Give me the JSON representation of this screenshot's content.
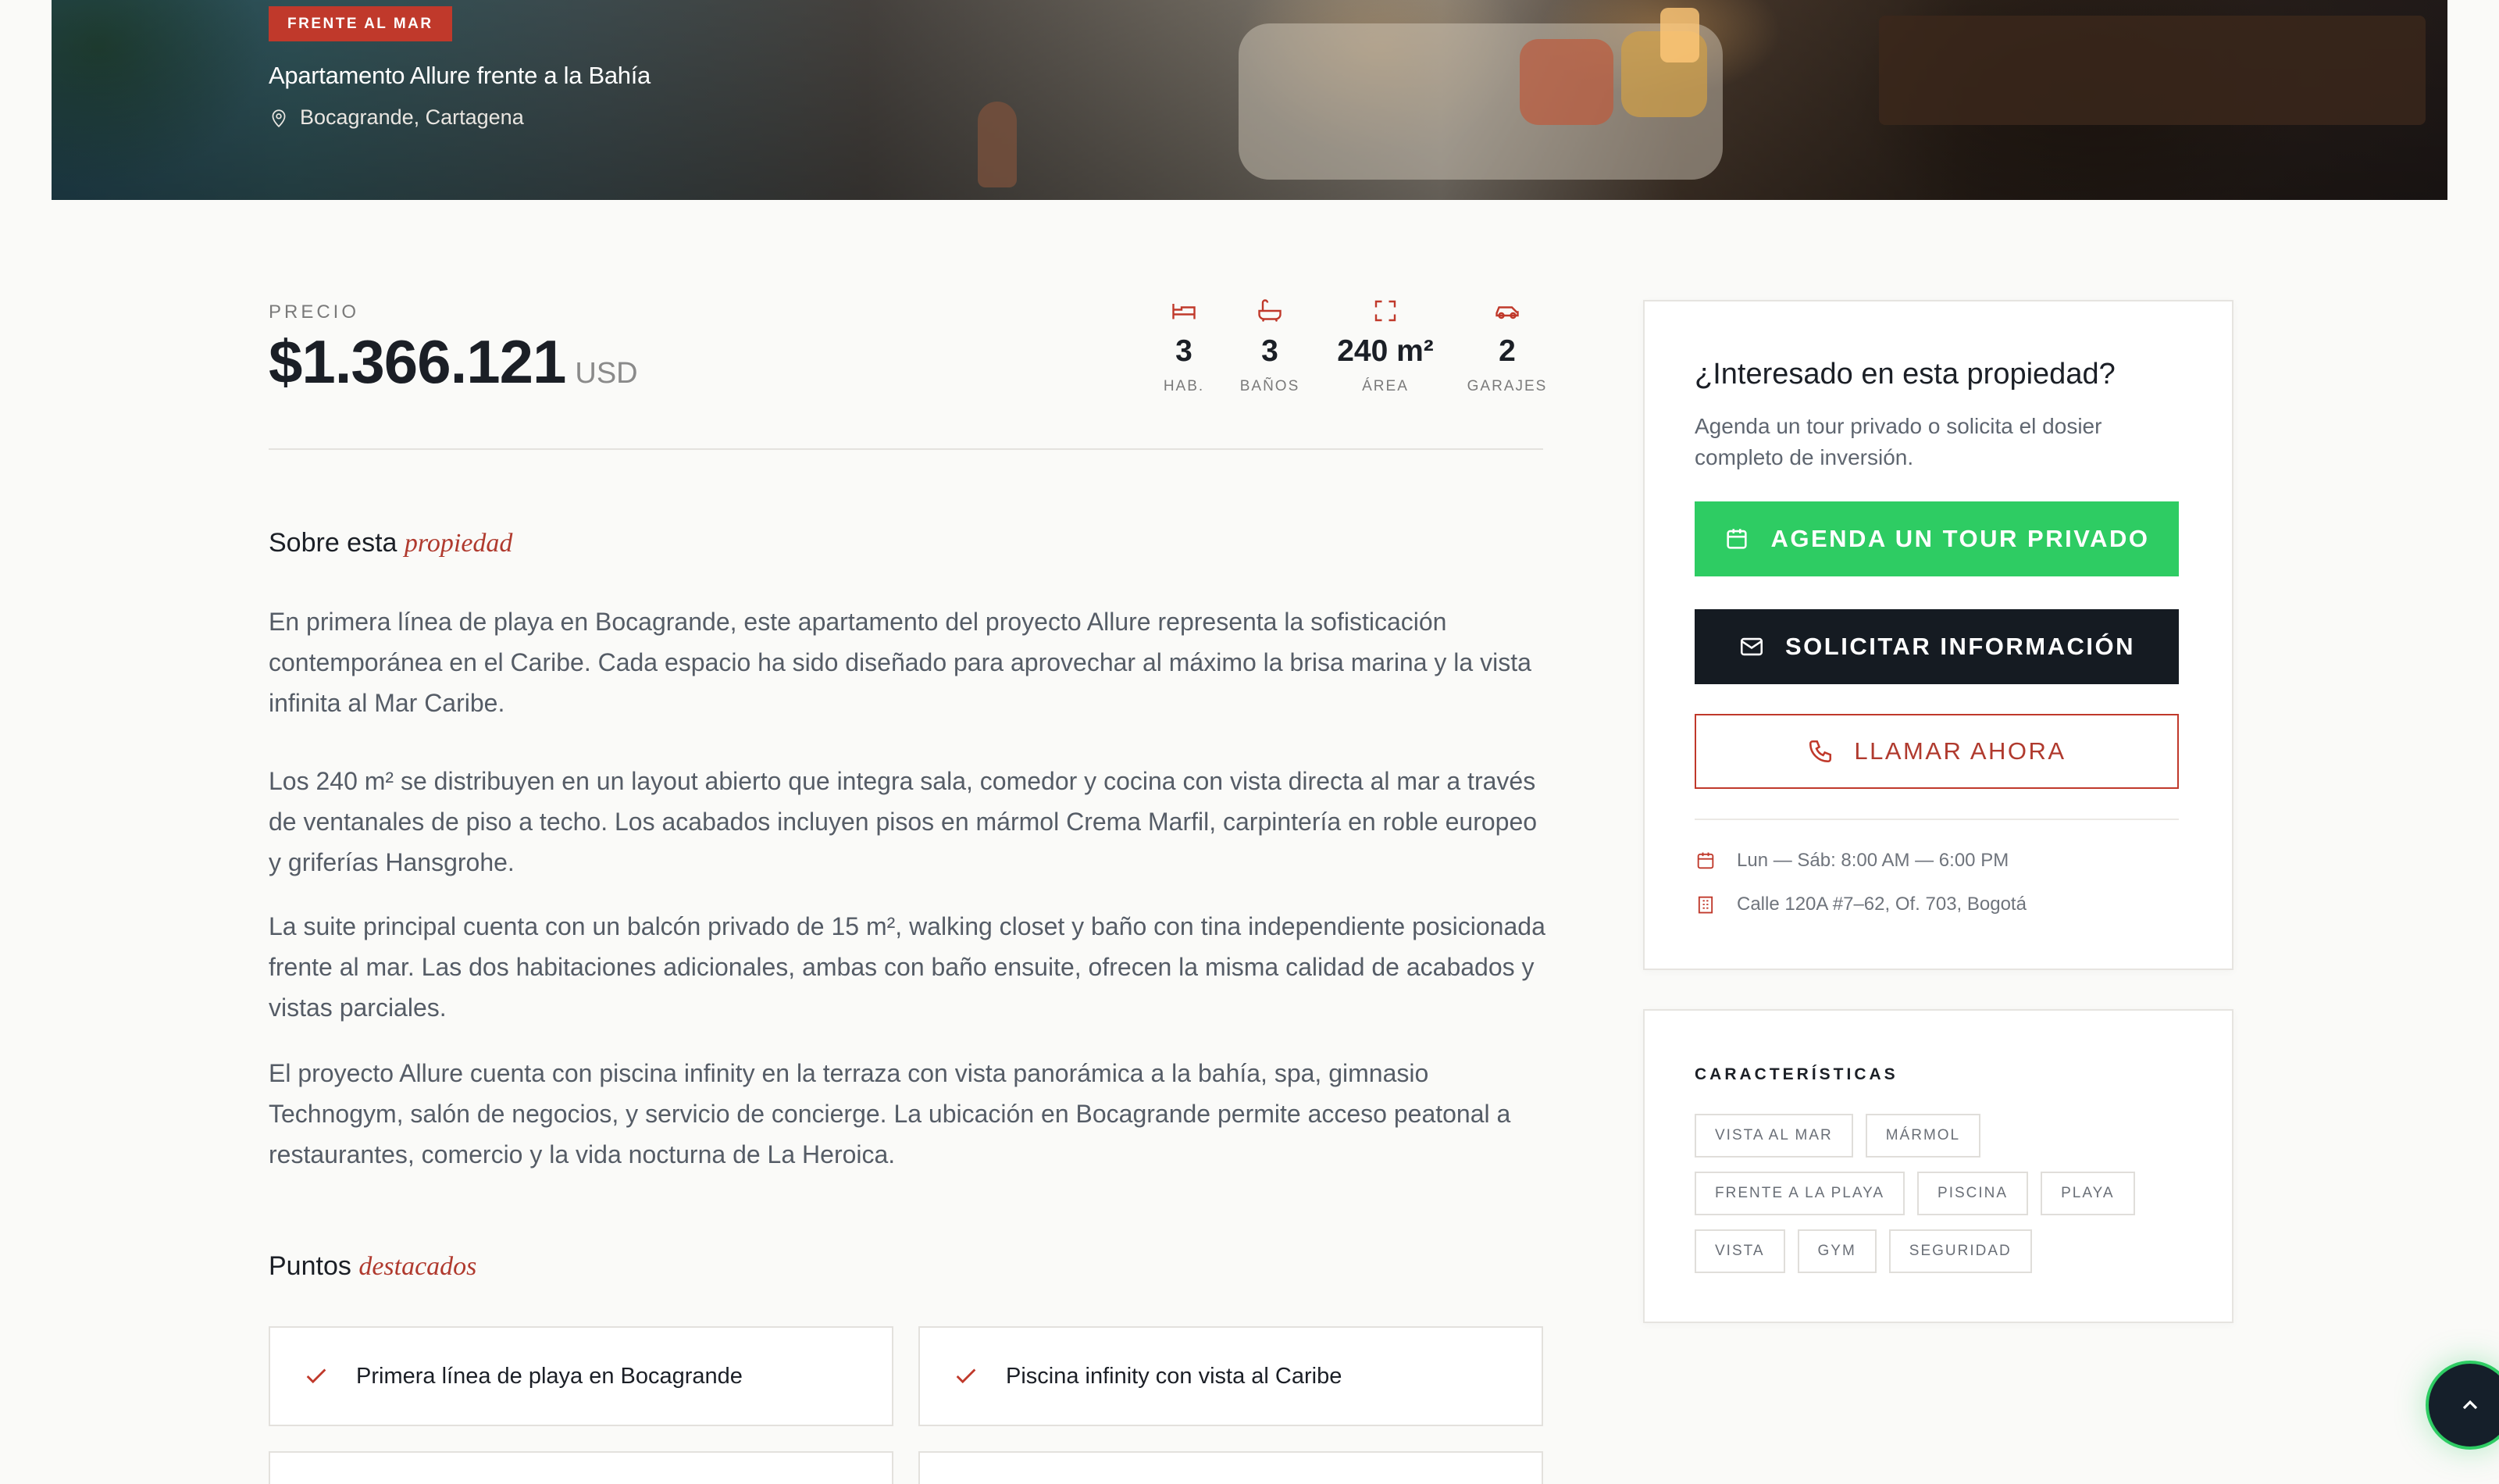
{
  "hero": {
    "badge": "FRENTE AL MAR",
    "title": "Apartamento Allure frente a la Bahía",
    "location": "Bocagrande, Cartagena",
    "location_icon": "map-pin-icon"
  },
  "price": {
    "label": "PRECIO",
    "value": "$1.366.121",
    "currency": "USD"
  },
  "stats": [
    {
      "icon": "bed-icon",
      "value": "3",
      "label": "HAB."
    },
    {
      "icon": "bathtub-icon",
      "value": "3",
      "label": "BAÑOS"
    },
    {
      "icon": "area-icon",
      "value": "240 m²",
      "label": "ÁREA"
    },
    {
      "icon": "car-icon",
      "value": "2",
      "label": "GARAJES"
    }
  ],
  "about": {
    "title_plain": "Sobre esta",
    "title_em": "propiedad",
    "paragraphs": [
      "En primera línea de playa en Bocagrande, este apartamento del proyecto Allure representa la sofisticación contemporánea en el Caribe. Cada espacio ha sido diseñado para aprovechar al máximo la brisa marina y la vista infinita al Mar Caribe.",
      "Los 240 m² se distribuyen en un layout abierto que integra sala, comedor y cocina con vista directa al mar a través de ventanales de piso a techo. Los acabados incluyen pisos en mármol Crema Marfil, carpintería en roble europeo y griferías Hansgrohe.",
      "La suite principal cuenta con un balcón privado de 15 m², walking closet y baño con tina independiente posicionada frente al mar. Las dos habitaciones adicionales, ambas con baño ensuite, ofrecen la misma calidad de acabados y vistas parciales.",
      "El proyecto Allure cuenta con piscina infinity en la terraza con vista panorámica a la bahía, spa, gimnasio Technogym, salón de negocios, y servicio de concierge. La ubicación en Bocagrande permite acceso peatonal a restaurantes, comercio y la vida nocturna de La Heroica."
    ]
  },
  "highlights": {
    "title_plain": "Puntos",
    "title_em": "destacados",
    "items": [
      "Primera línea de playa en Bocagrande",
      "Piscina infinity con vista al Caribe"
    ]
  },
  "contact_card": {
    "title": "¿Interesado en esta propiedad?",
    "subtitle": "Agenda un tour privado o solicita el dosier completo de inversión.",
    "btn_tour": "AGENDA UN TOUR PRIVADO",
    "btn_info": "SOLICITAR INFORMACIÓN",
    "btn_call": "LLAMAR AHORA",
    "hours": "Lun — Sáb: 8:00 AM — 6:00 PM",
    "address": "Calle 120A #7–62, Of. 703, Bogotá"
  },
  "features": {
    "title": "CARACTERÍSTICAS",
    "rows": [
      [
        "VISTA AL MAR",
        "MÁRMOL"
      ],
      [
        "FRENTE A LA PLAYA",
        "PISCINA",
        "PLAYA"
      ],
      [
        "VISTA",
        "GYM",
        "SEGURIDAD"
      ]
    ]
  },
  "colors": {
    "accent": "#c0392b",
    "green": "#2ecc63",
    "dark": "#151b22"
  }
}
